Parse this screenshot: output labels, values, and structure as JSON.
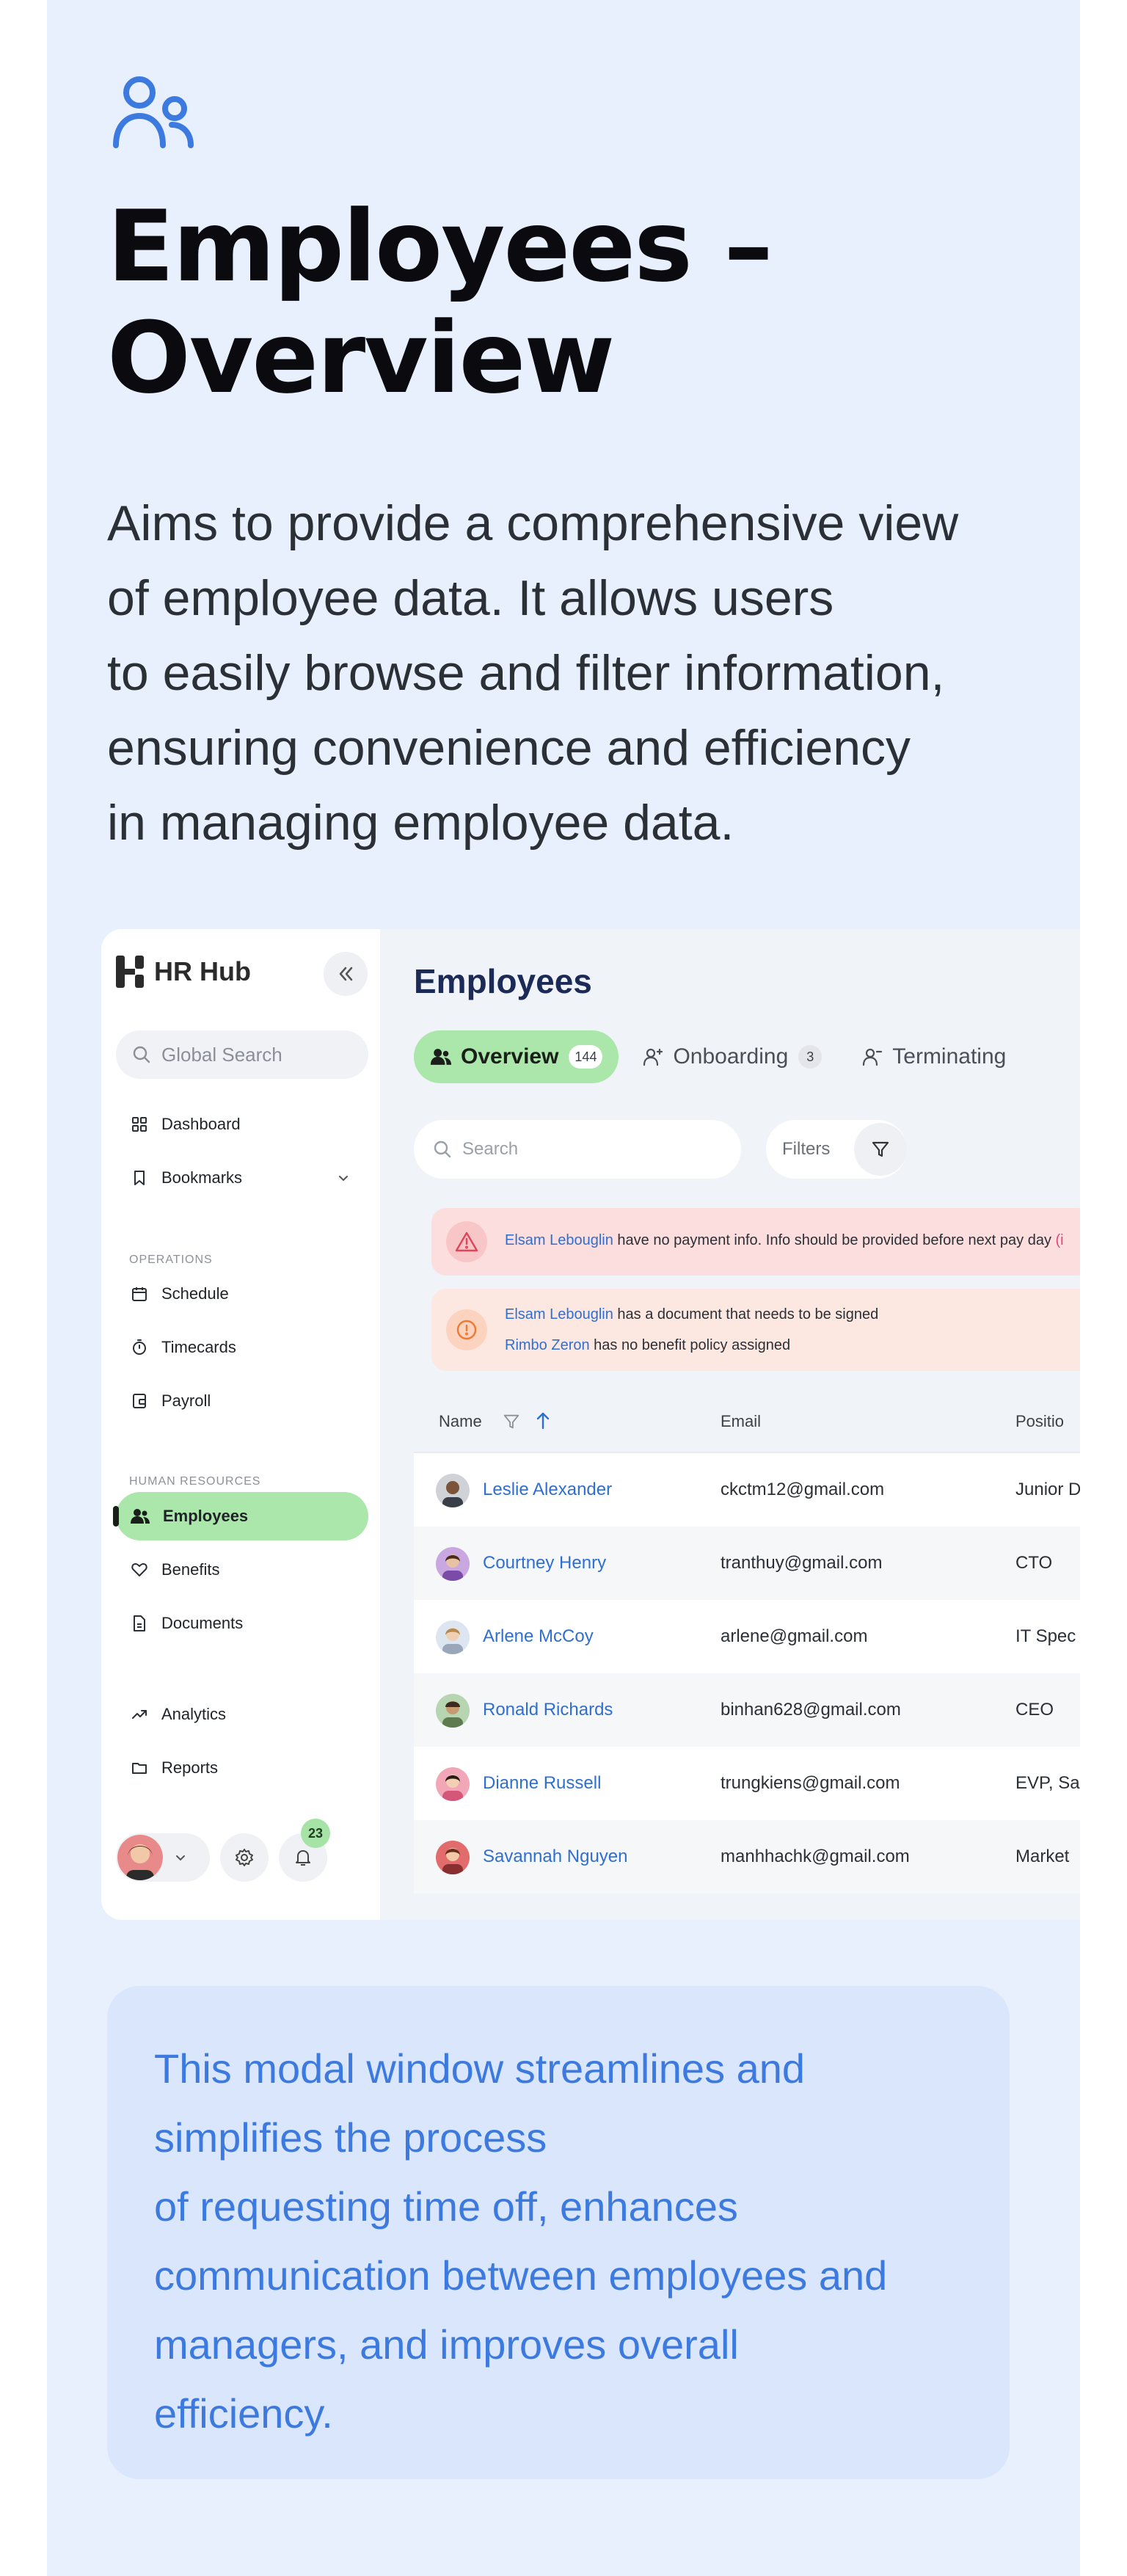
{
  "hero": {
    "icon": "users-icon",
    "title_line1": "Employees –",
    "title_line2": "Overview",
    "description": [
      "Aims to provide a comprehensive view",
      "of employee data. It allows users",
      "to easily browse and filter information,",
      "ensuring convenience and efficiency",
      "in managing employee data."
    ]
  },
  "app": {
    "brand": "HR Hub",
    "global_search_placeholder": "Global Search",
    "nav": {
      "dashboard": "Dashboard",
      "bookmarks": "Bookmarks",
      "operations_label": "OPERATIONS",
      "schedule": "Schedule",
      "timecards": "Timecards",
      "payroll": "Payroll",
      "hr_label": "HUMAN RESOURCES",
      "employees": "Employees",
      "benefits": "Benefits",
      "documents": "Documents",
      "analytics": "Analytics",
      "reports": "Reports"
    },
    "notifications_count": "23",
    "page_title": "Employees",
    "tabs": [
      {
        "label": "Overview",
        "count": "144"
      },
      {
        "label": "Onboarding",
        "count": "3"
      },
      {
        "label": "Terminating",
        "count": ""
      }
    ],
    "search_placeholder": "Search",
    "filters_label": "Filters",
    "alerts": {
      "a1_link": "Elsam Lebouglin",
      "a1_text": " have no payment info. Info should be provided before next pay day ",
      "a1_tail": "(i",
      "a2_link1": "Elsam Lebouglin",
      "a2_text1": " has a document that needs to be signed",
      "a2_link2": "Rimbo Zeron",
      "a2_text2": " has no benefit policy assigned"
    },
    "table": {
      "headers": {
        "name": "Name",
        "email": "Email",
        "position": "Positio"
      },
      "rows": [
        {
          "name": "Leslie Alexander",
          "email": "ckctm12@gmail.com",
          "position": "Junior D"
        },
        {
          "name": "Courtney Henry",
          "email": "tranthuy@gmail.com",
          "position": "CTO"
        },
        {
          "name": "Arlene McCoy",
          "email": "arlene@gmail.com",
          "position": "IT Spec"
        },
        {
          "name": "Ronald Richards",
          "email": "binhan628@gmail.com",
          "position": "CEO"
        },
        {
          "name": "Dianne Russell",
          "email": "trungkiens@gmail.com",
          "position": "EVP, Sa"
        },
        {
          "name": "Savannah Nguyen",
          "email": "manhhachk@gmail.com",
          "position": "Market"
        }
      ]
    }
  },
  "note": {
    "lines": [
      "This modal window streamlines and",
      "simplifies the process",
      "of requesting time off, enhances",
      "communication between employees and",
      "managers, and improves overall",
      "efficiency."
    ]
  },
  "colors": {
    "page_bg": "#e8f0fe",
    "accent_green": "#abe6ab",
    "link_blue": "#2f6fd0",
    "note_bg": "#d9e6fb",
    "note_text": "#3d7ae0"
  }
}
